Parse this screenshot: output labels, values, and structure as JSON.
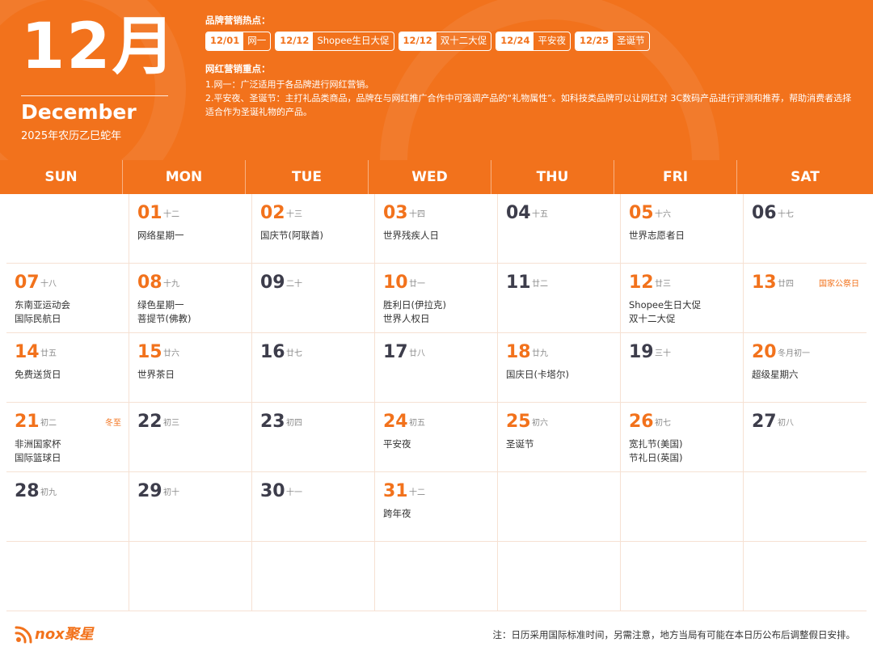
{
  "header": {
    "month_number": "12月",
    "month_english": "December",
    "lunar_year": "2025年农历乙巳蛇年",
    "brand_hotspots_title": "品牌营销热点：",
    "brand_hotspots": [
      {
        "date": "12/01",
        "name": "网一"
      },
      {
        "date": "12/12",
        "name": "Shopee生日大促"
      },
      {
        "date": "12/12",
        "name": "双十二大促"
      },
      {
        "date": "12/24",
        "name": "平安夜"
      },
      {
        "date": "12/25",
        "name": "圣诞节"
      }
    ],
    "influencer_focus_title": "网红营销重点：",
    "influencer_notes": [
      "1.网一：广泛适用于各品牌进行网红营销。",
      "2.平安夜、圣诞节：主打礼品类商品，品牌在与网红推广合作中可强调产品的“礼物属性”。如科技类品牌可以让网红对 3C数码产品进行评测和推荐，帮助消费者选择适合作为圣诞礼物的产品。"
    ]
  },
  "weekdays": [
    "SUN",
    "MON",
    "TUE",
    "WED",
    "THU",
    "FRI",
    "SAT"
  ],
  "days": [
    {
      "num": "01",
      "lunar": "十二",
      "events": [
        "网络星期一"
      ],
      "highlight": true,
      "holiday": ""
    },
    {
      "num": "02",
      "lunar": "十三",
      "events": [
        "国庆节(阿联酋)"
      ],
      "highlight": true,
      "holiday": ""
    },
    {
      "num": "03",
      "lunar": "十四",
      "events": [
        "世界残疾人日"
      ],
      "highlight": true,
      "holiday": ""
    },
    {
      "num": "04",
      "lunar": "十五",
      "events": [],
      "highlight": false,
      "holiday": ""
    },
    {
      "num": "05",
      "lunar": "十六",
      "events": [
        "世界志愿者日"
      ],
      "highlight": true,
      "holiday": ""
    },
    {
      "num": "06",
      "lunar": "十七",
      "events": [],
      "highlight": false,
      "holiday": ""
    },
    {
      "num": "07",
      "lunar": "十八",
      "events": [
        "东南亚运动会",
        "国际民航日"
      ],
      "highlight": true,
      "holiday": ""
    },
    {
      "num": "08",
      "lunar": "十九",
      "events": [
        "绿色星期一",
        "菩提节(佛教)"
      ],
      "highlight": true,
      "holiday": ""
    },
    {
      "num": "09",
      "lunar": "二十",
      "events": [],
      "highlight": false,
      "holiday": ""
    },
    {
      "num": "10",
      "lunar": "廿一",
      "events": [
        "胜利日(伊拉克)",
        "世界人权日"
      ],
      "highlight": true,
      "holiday": ""
    },
    {
      "num": "11",
      "lunar": "廿二",
      "events": [],
      "highlight": false,
      "holiday": ""
    },
    {
      "num": "12",
      "lunar": "廿三",
      "events": [
        "Shopee生日大促",
        "双十二大促"
      ],
      "highlight": true,
      "holiday": ""
    },
    {
      "num": "13",
      "lunar": "廿四",
      "events": [],
      "highlight": true,
      "holiday": "国家公祭日"
    },
    {
      "num": "14",
      "lunar": "廿五",
      "events": [
        "免费送货日"
      ],
      "highlight": true,
      "holiday": ""
    },
    {
      "num": "15",
      "lunar": "廿六",
      "events": [
        "世界茶日"
      ],
      "highlight": true,
      "holiday": ""
    },
    {
      "num": "16",
      "lunar": "廿七",
      "events": [],
      "highlight": false,
      "holiday": ""
    },
    {
      "num": "17",
      "lunar": "廿八",
      "events": [],
      "highlight": false,
      "holiday": ""
    },
    {
      "num": "18",
      "lunar": "廿九",
      "events": [
        "国庆日(卡塔尔)"
      ],
      "highlight": true,
      "holiday": ""
    },
    {
      "num": "19",
      "lunar": "三十",
      "events": [],
      "highlight": false,
      "holiday": ""
    },
    {
      "num": "20",
      "lunar": "冬月初一",
      "events": [
        "超级星期六"
      ],
      "highlight": true,
      "holiday": ""
    },
    {
      "num": "21",
      "lunar": "初二",
      "events": [
        "非洲国家杯",
        "国际篮球日"
      ],
      "highlight": true,
      "holiday": "冬至"
    },
    {
      "num": "22",
      "lunar": "初三",
      "events": [],
      "highlight": false,
      "holiday": ""
    },
    {
      "num": "23",
      "lunar": "初四",
      "events": [],
      "highlight": false,
      "holiday": ""
    },
    {
      "num": "24",
      "lunar": "初五",
      "events": [
        "平安夜"
      ],
      "highlight": true,
      "holiday": ""
    },
    {
      "num": "25",
      "lunar": "初六",
      "events": [
        "圣诞节"
      ],
      "highlight": true,
      "holiday": ""
    },
    {
      "num": "26",
      "lunar": "初七",
      "events": [
        "宽扎节(美国)",
        "节礼日(英国)"
      ],
      "highlight": true,
      "holiday": ""
    },
    {
      "num": "27",
      "lunar": "初八",
      "events": [],
      "highlight": false,
      "holiday": ""
    },
    {
      "num": "28",
      "lunar": "初九",
      "events": [],
      "highlight": false,
      "holiday": ""
    },
    {
      "num": "29",
      "lunar": "初十",
      "events": [],
      "highlight": false,
      "holiday": ""
    },
    {
      "num": "30",
      "lunar": "十一",
      "events": [],
      "highlight": false,
      "holiday": ""
    },
    {
      "num": "31",
      "lunar": "十二",
      "events": [
        "跨年夜"
      ],
      "highlight": true,
      "holiday": ""
    }
  ],
  "first_weekday_index": 1,
  "footer": {
    "logo_icon": "nox-signal-icon",
    "logo_text": "nox聚星",
    "note": "注：日历采用国际标准时间，另需注意，地方当局有可能在本日历公布后调整假日安排。"
  },
  "colors": {
    "accent": "#f2721c",
    "dark_number": "#3d3d4b",
    "grid_line": "#f6e1d3"
  }
}
